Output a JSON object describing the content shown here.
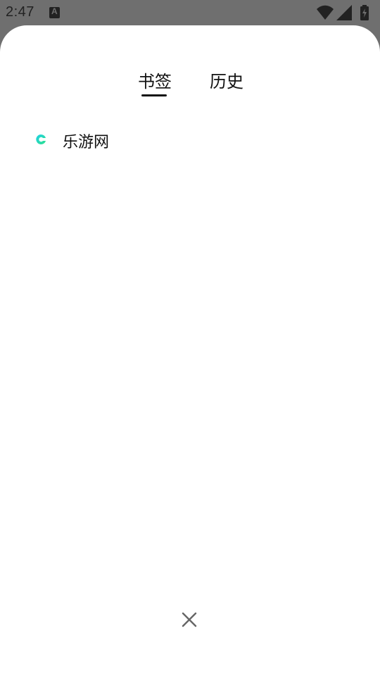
{
  "status_bar": {
    "time": "2:47",
    "icons": [
      "text-a-icon",
      "wifi-icon",
      "signal-icon",
      "battery-icon"
    ]
  },
  "tabs": [
    {
      "label": "书签",
      "active": true
    },
    {
      "label": "历史",
      "active": false
    }
  ],
  "bookmarks": [
    {
      "title": "乐游网",
      "icon": "site-favicon-icon"
    }
  ],
  "close_icon": "close-icon",
  "colors": {
    "scrim": "#6f6f6f",
    "sheet": "#ffffff",
    "text": "#111111",
    "favicon_cyan": "#1fd1e6",
    "favicon_green": "#2fe08a",
    "close_gray": "#666666"
  }
}
